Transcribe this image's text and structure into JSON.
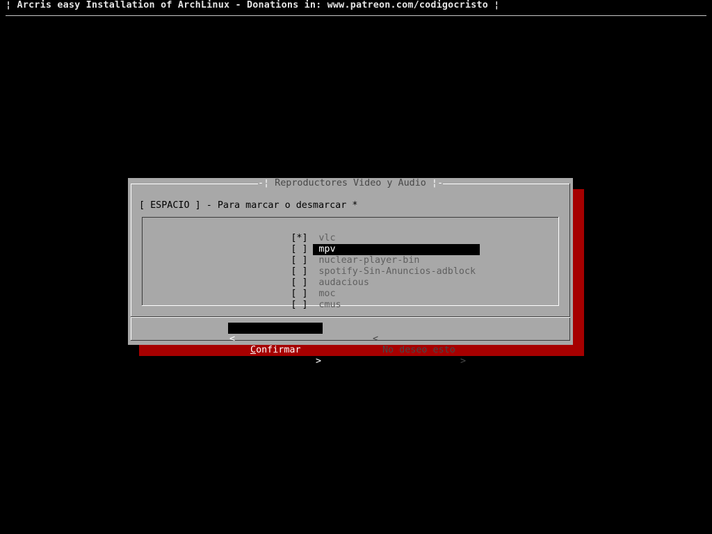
{
  "backtitle": "¦ Arcris easy Installation of ArchLinux - Donations in: www.patreon.com/codigocristo ¦",
  "dialog": {
    "title": "Reproductores Video y Audio",
    "title_left_deco": "-¦ ",
    "title_right_deco": " ¦-",
    "instructions": "[ ESPACIO ] - Para marcar o desmarcar *",
    "items": [
      {
        "mark": "[*]",
        "label": "vlc",
        "checked": true,
        "selected": false
      },
      {
        "mark": "[ ]",
        "label": "mpv",
        "checked": false,
        "selected": true
      },
      {
        "mark": "[ ]",
        "label": "nuclear-player-bin",
        "checked": false,
        "selected": false
      },
      {
        "mark": "[ ]",
        "label": "spotify-Sin-Anuncios-adblock",
        "checked": false,
        "selected": false
      },
      {
        "mark": "[ ]",
        "label": "audacious",
        "checked": false,
        "selected": false
      },
      {
        "mark": "[ ]",
        "label": "moc",
        "checked": false,
        "selected": false
      },
      {
        "mark": "[ ]",
        "label": "cmus",
        "checked": false,
        "selected": false
      }
    ],
    "ok_button": {
      "lt": "<",
      "gt": ">",
      "hot": "C",
      "rest": "onfirmar",
      "focused": true
    },
    "cancel_button": {
      "lt": "<",
      "gt": ">",
      "label": "No deseo esto",
      "focused": false
    }
  },
  "colors": {
    "screen_bg": "#000000",
    "dialog_bg": "#a8a8a8",
    "dialog_shadow": "#a60000",
    "selection_bg": "#000000",
    "selection_fg": "#ffffff",
    "item_fg": "#606060"
  }
}
